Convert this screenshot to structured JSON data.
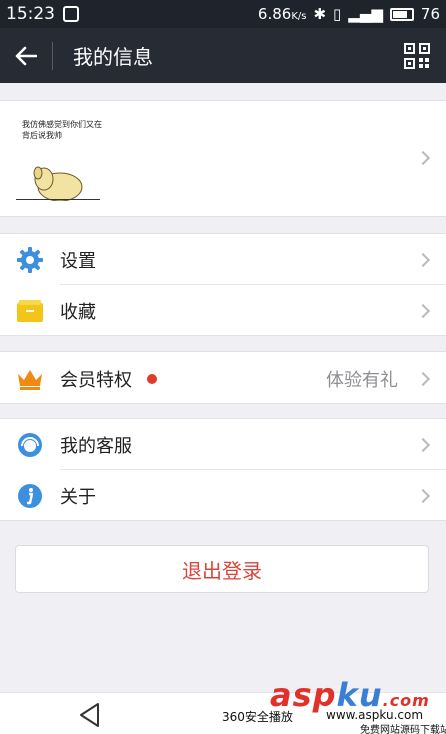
{
  "status_bar": {
    "time": "15:23",
    "speed": "6.86",
    "speed_unit": "K/s",
    "battery": "76"
  },
  "app_bar": {
    "title": "我的信息"
  },
  "profile": {
    "avatar_caption": "我仿佛感觉到你们又在背后说我帅"
  },
  "menu": {
    "settings": "设置",
    "favorites": "收藏",
    "vip": "会员特权",
    "vip_trail": "体验有礼",
    "service": "我的客服",
    "about": "关于"
  },
  "logout": {
    "label": "退出登录"
  },
  "watermark": {
    "brand_a": "asp",
    "brand_b": "ku",
    "brand_c": ".com",
    "caption": "360安全播放",
    "caption2": "www.aspku.com",
    "caption3": "免费网站源码下载站"
  },
  "colors": {
    "header": "#272b33",
    "accent_blue": "#3d8fe0",
    "accent_yellow": "#f2c518",
    "accent_orange": "#f08a12",
    "danger": "#d9453b"
  }
}
